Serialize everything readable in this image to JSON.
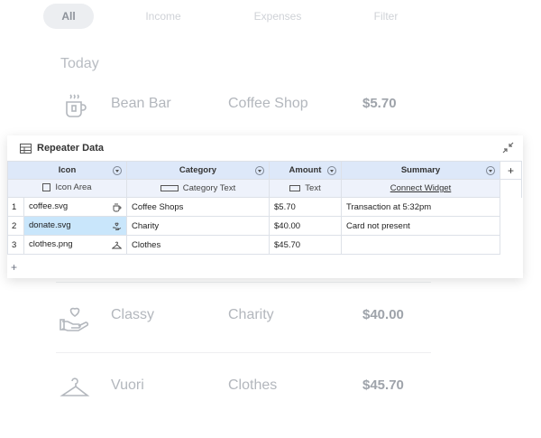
{
  "filters": [
    "All",
    "Income",
    "Expenses",
    "Filter"
  ],
  "section_label": "Today",
  "transactions": [
    {
      "name": "Bean Bar",
      "category": "Coffee Shop",
      "amount": "$5.70",
      "icon": "coffee-cup-icon"
    },
    {
      "name": "Classy",
      "category": "Charity",
      "amount": "$40.00",
      "icon": "donate-hand-heart-icon"
    },
    {
      "name": "Vuori",
      "category": "Clothes",
      "amount": "$45.70",
      "icon": "clothes-hanger-icon"
    }
  ],
  "repeater": {
    "title": "Repeater Data",
    "columns": [
      {
        "header": "Icon",
        "type": "Icon Area"
      },
      {
        "header": "Category",
        "type": "Category Text"
      },
      {
        "header": "Amount",
        "type": "Text"
      },
      {
        "header": "Summary",
        "type": "Connect Widget"
      }
    ],
    "add_column": "+",
    "add_row": "+",
    "rows": [
      {
        "num": "1",
        "icon_file": "coffee.svg",
        "category": "Coffee Shops",
        "amount": "$5.70",
        "summary": "Transaction at 5:32pm"
      },
      {
        "num": "2",
        "icon_file": "donate.svg",
        "category": "Charity",
        "amount": "$40.00",
        "summary": "Card not present"
      },
      {
        "num": "3",
        "icon_file": "clothes.png",
        "category": "Clothes",
        "amount": "$45.70",
        "summary": ""
      }
    ]
  },
  "colors": {
    "header_bg": "#dde8f9",
    "selected_cell": "#c9e6fb"
  }
}
